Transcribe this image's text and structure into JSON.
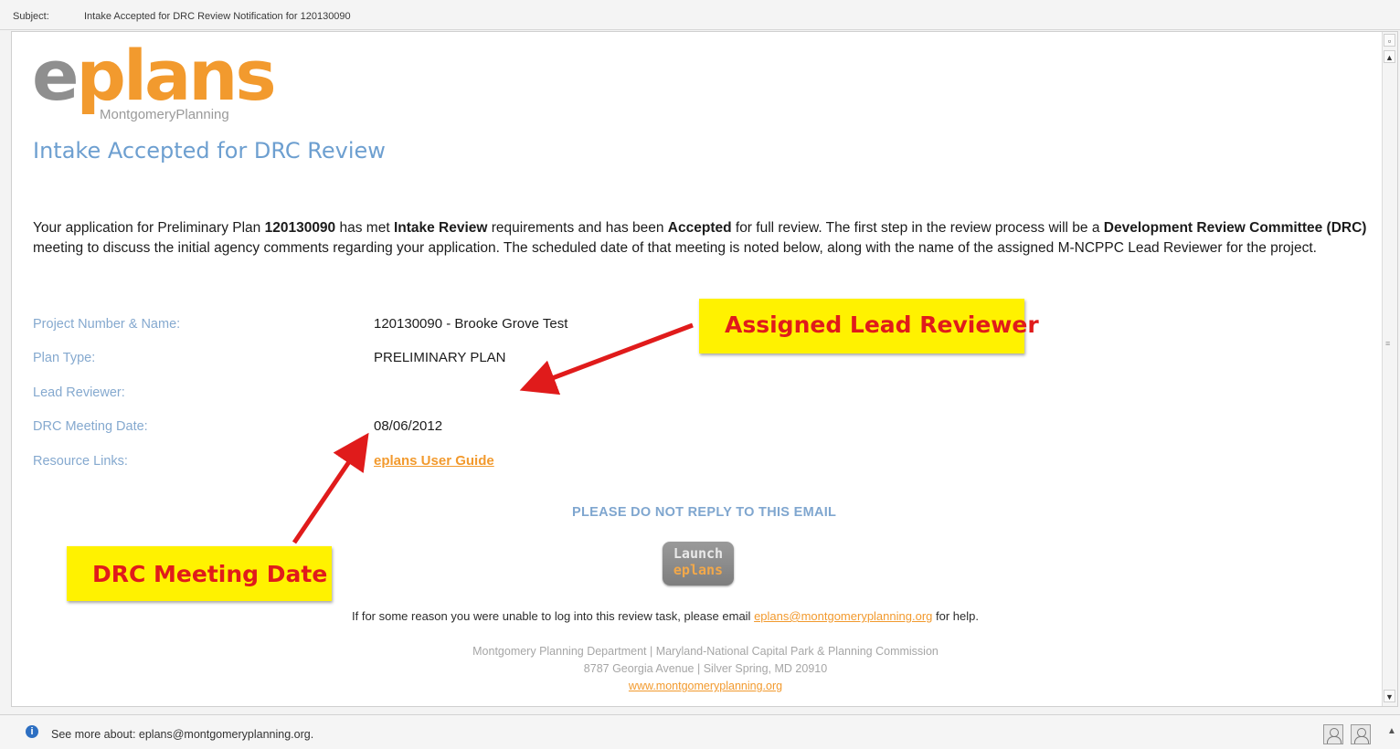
{
  "subject": {
    "label": "Subject:",
    "value": "Intake Accepted for DRC Review Notification for 120130090"
  },
  "logo": {
    "e": "e",
    "rest": "plans",
    "sub": "MontgomeryPlanning"
  },
  "heading": "Intake Accepted for DRC Review",
  "intro": {
    "t1": "Your application for Preliminary Plan ",
    "b1": "120130090",
    "t2": " has met ",
    "b2": "Intake Review",
    "t3": " requirements and has been ",
    "b3": "Accepted",
    "t4": " for full review. The first step in the review process will be a ",
    "b4": "Development Review Committee (DRC)",
    "t5": " meeting to discuss the initial agency comments regarding your application. The scheduled date of that meeting is noted below, along with the name of the assigned M-NCPPC Lead Reviewer for the project."
  },
  "fields": {
    "project_label": "Project Number & Name:",
    "project_value": "120130090 - Brooke Grove Test",
    "plan_label": "Plan Type:",
    "plan_value": "PRELIMINARY PLAN",
    "reviewer_label": "Lead Reviewer:",
    "reviewer_value": "",
    "date_label": "DRC Meeting Date:",
    "date_value": "08/06/2012",
    "links_label": "Resource Links:",
    "links_value": "eplans User Guide"
  },
  "noreply": "PLEASE DO NOT REPLY TO THIS EMAIL",
  "launch": {
    "line1": "Launch",
    "line2": "eplans"
  },
  "help": {
    "before": "If for some reason you were unable to log into this review task, please email ",
    "email": "eplans@montgomeryplanning.org",
    "after": " for help."
  },
  "footer": {
    "line1": "Montgomery Planning Department | Maryland-National Capital Park & Planning Commission",
    "line2": "8787 Georgia Avenue | Silver Spring, MD 20910",
    "link": "www.montgomeryplanning.org"
  },
  "callouts": {
    "lead_reviewer": "Assigned Lead Reviewer",
    "drc_date": "DRC Meeting Date"
  },
  "status": {
    "text": "See more about: eplans@montgomeryplanning.org.",
    "icon": "info-icon"
  },
  "colors": {
    "brand_orange": "#f29a2e",
    "heading_blue": "#6d9fd0",
    "callout_yellow": "#fff200",
    "callout_red": "#e01b1b"
  }
}
